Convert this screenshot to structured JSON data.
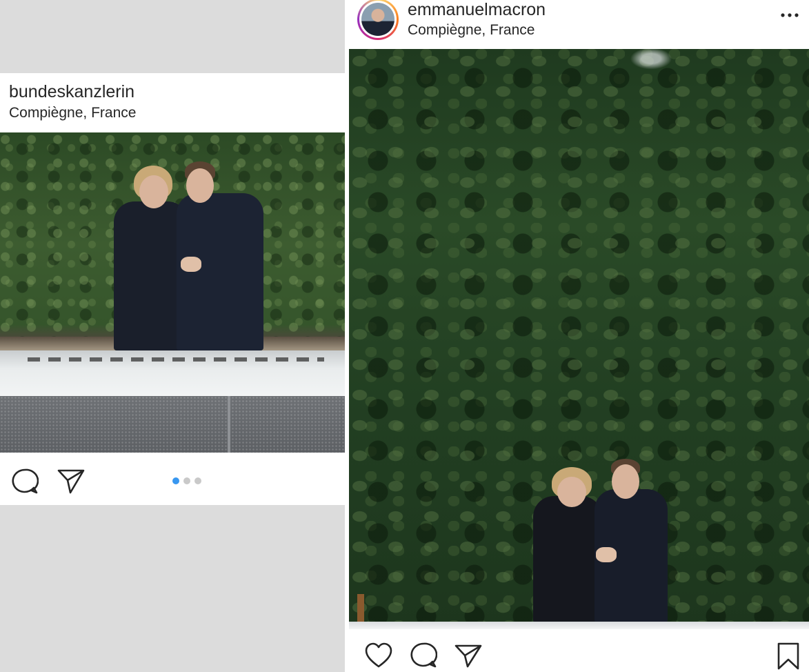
{
  "left_post": {
    "username": "bundeskanzlerin",
    "location": "Compiègne, France",
    "carousel": {
      "count": 3,
      "active_index": 0
    }
  },
  "right_post": {
    "username": "emmanuelmacron",
    "location": "Compiègne, France"
  },
  "icons": {
    "comment": "comment-icon",
    "share": "send-icon",
    "like": "heart-icon",
    "save": "bookmark-icon",
    "more": "more-options-icon"
  },
  "colors": {
    "carousel_active": "#3897f0",
    "carousel_inactive": "#c9c9c9",
    "text": "#262626"
  }
}
